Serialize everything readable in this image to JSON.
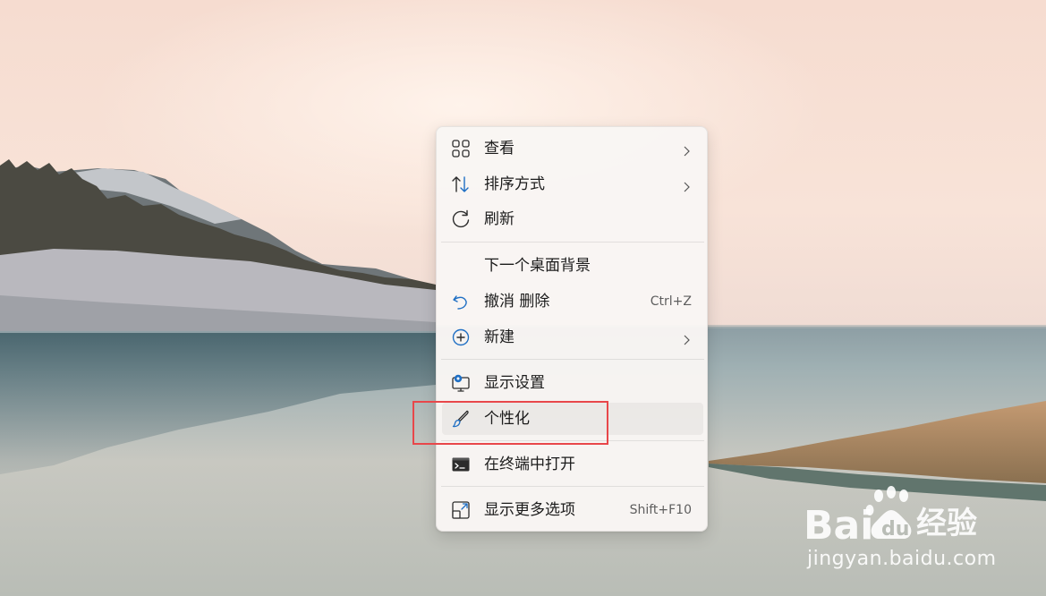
{
  "context_menu": {
    "items": [
      {
        "label": "查看",
        "icon": "grid-icon",
        "submenu": true
      },
      {
        "label": "排序方式",
        "icon": "sort-icon",
        "submenu": true
      },
      {
        "label": "刷新",
        "icon": "refresh-icon"
      },
      {
        "label": "下一个桌面背景",
        "icon": ""
      },
      {
        "label": "撤消 删除",
        "icon": "undo-icon",
        "shortcut": "Ctrl+Z"
      },
      {
        "label": "新建",
        "icon": "new-plus-icon",
        "submenu": true
      },
      {
        "label": "显示设置",
        "icon": "display-settings-icon"
      },
      {
        "label": "个性化",
        "icon": "brush-icon",
        "state": "hovered"
      },
      {
        "label": "在终端中打开",
        "icon": "terminal-icon"
      },
      {
        "label": "显示更多选项",
        "icon": "more-options-icon",
        "shortcut": "Shift+F10"
      }
    ]
  },
  "annotation": {
    "highlight_color": "#e8474a",
    "target": "个性化"
  },
  "watermark": {
    "logo_text": "Bai 经验",
    "url": "jingyan.baidu.com"
  },
  "colors": {
    "accent": "#1f6fc4",
    "menu_bg": "#f9f6f4"
  }
}
